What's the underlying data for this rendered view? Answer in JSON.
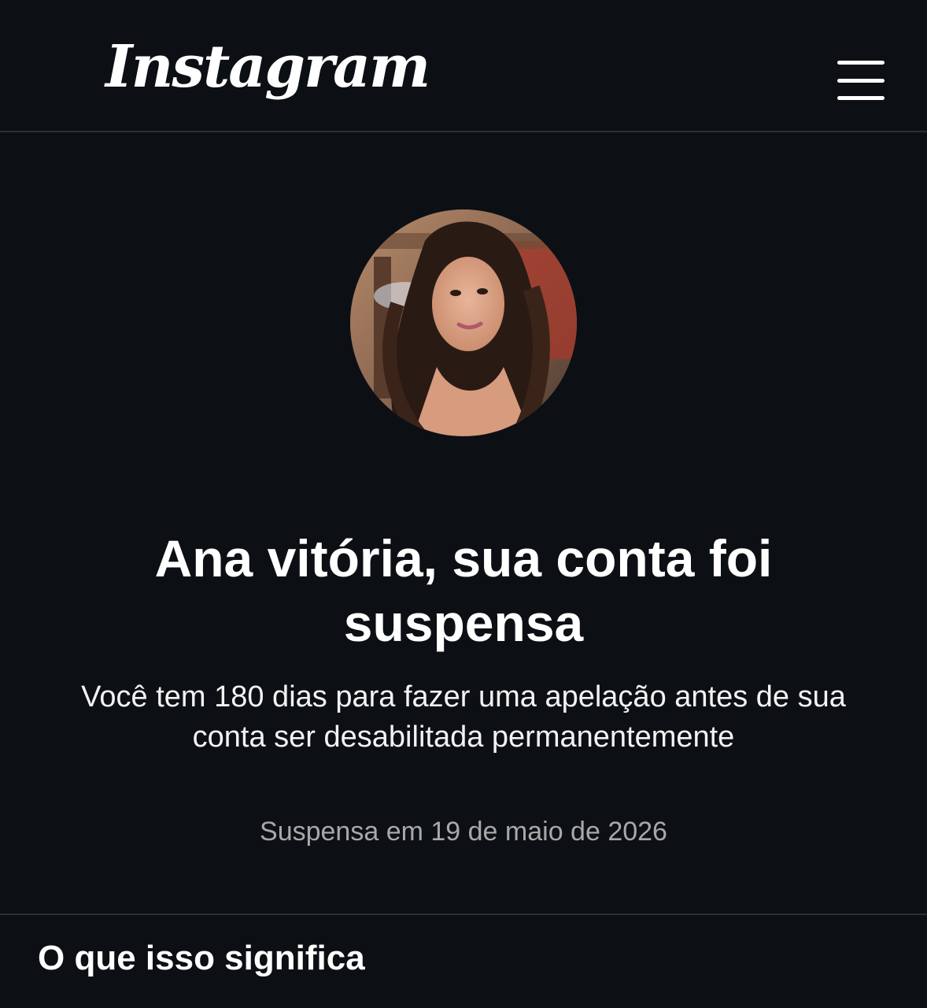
{
  "header": {
    "logo_text": "Instagram",
    "menu_icon": "hamburger-menu-icon"
  },
  "profile": {
    "avatar_description_icon": "profile-photo"
  },
  "notice": {
    "headline": "Ana vitória, sua conta foi suspensa",
    "description": "Você tem 180 dias para fazer uma apelação antes de sua conta ser desabilitada permanentemente",
    "suspended_on": "Suspensa em 19 de maio de 2026"
  },
  "section": {
    "title": "O que isso significa"
  },
  "colors": {
    "background": "#0c1014",
    "text_primary": "#ffffff",
    "text_secondary": "#a8a8a8",
    "divider": "#2a2f33"
  }
}
